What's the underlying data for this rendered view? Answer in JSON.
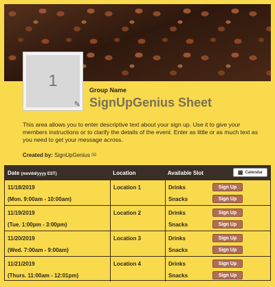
{
  "avatar": {
    "number": "1"
  },
  "group_label": "Group Name",
  "title": "SignUpGenius Sheet",
  "description": "This area allows you to enter descriptive text about your sign up. Use it to give your members instructions or to clarify the details of the event. Enter as little or as much text as you need to get your message across.",
  "created_by": {
    "label": "Created by:",
    "name": "SignUpGenius"
  },
  "table": {
    "headers": {
      "date": "Date",
      "date_format": "(mm/dd/yyyy EST)",
      "location": "Location",
      "slot": "Available Slot",
      "calendar_button": "Calendar"
    },
    "rows": [
      {
        "date": "11/18/2019",
        "time": "(Mon. 9:00am - 10:00am)",
        "location": "Location 1",
        "slots": [
          "Drinks",
          "Snacks"
        ]
      },
      {
        "date": "11/19/2019",
        "time": "(Tue. 1:00pm - 3:00pm)",
        "location": "Location 2",
        "slots": [
          "Drinks",
          "Snacks"
        ]
      },
      {
        "date": "11/20/2019",
        "time": "(Wed. 7:00am - 9:00am)",
        "location": "Location 3",
        "slots": [
          "Drinks",
          "Snacks"
        ]
      },
      {
        "date": "11/21/2019",
        "time": "(Thurs. 11:00am - 12:01pm)",
        "location": "Location 4",
        "slots": [
          "Drinks",
          "Snacks"
        ]
      }
    ],
    "signup_label": "Sign Up"
  },
  "colors": {
    "background": "#f9da4d",
    "header_bg": "#3a2f26",
    "button": "#b06f55",
    "title": "#7a6f58"
  }
}
